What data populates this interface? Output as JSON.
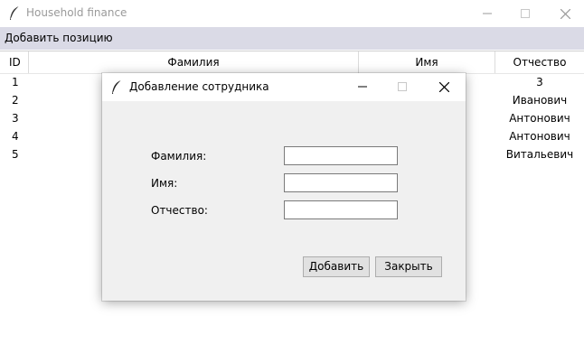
{
  "window": {
    "title": "Household finance",
    "icon": "feather-icon"
  },
  "menubar": {
    "items": [
      "Добавить позицию"
    ]
  },
  "table": {
    "columns": [
      "ID",
      "Фамилия",
      "Имя",
      "Отчество"
    ],
    "rows": [
      {
        "id": "1",
        "last_name": "",
        "first_name": "",
        "middle_name": "3"
      },
      {
        "id": "2",
        "last_name": "",
        "first_name": "",
        "middle_name": "Иванович"
      },
      {
        "id": "3",
        "last_name": "",
        "first_name": "",
        "middle_name": "Антонович"
      },
      {
        "id": "4",
        "last_name": "",
        "first_name": "",
        "middle_name": "Антонович"
      },
      {
        "id": "5",
        "last_name": "",
        "first_name": "",
        "middle_name": "Витальевич"
      }
    ]
  },
  "dialog": {
    "title": "Добавление сотрудника",
    "icon": "feather-icon",
    "fields": [
      {
        "label": "Фамилия:",
        "value": ""
      },
      {
        "label": "Имя:",
        "value": ""
      },
      {
        "label": "Отчество:",
        "value": ""
      }
    ],
    "add_button": "Добавить",
    "close_button": "Закрыть"
  }
}
